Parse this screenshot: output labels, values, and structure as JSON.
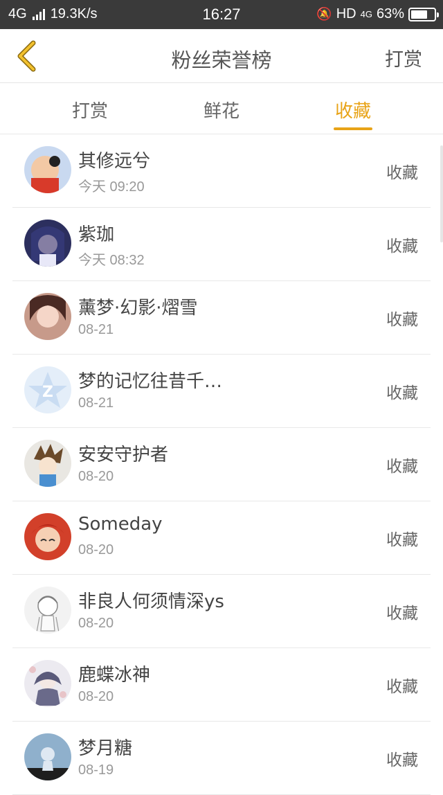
{
  "status_bar": {
    "network": "4G",
    "speed": "19.3K/s",
    "time": "16:27",
    "hd": "HD",
    "network2": "4G",
    "battery": "63%"
  },
  "nav": {
    "title": "粉丝荣誉榜",
    "action_label": "打赏"
  },
  "tabs": [
    {
      "label": "打赏",
      "active": false
    },
    {
      "label": "鲜花",
      "active": false
    },
    {
      "label": "收藏",
      "active": true
    }
  ],
  "accent_color": "#e8a317",
  "list": [
    {
      "name": "其修远兮",
      "time": "今天 09:20",
      "action": "收藏"
    },
    {
      "name": "紫珈",
      "time": "今天 08:32",
      "action": "收藏"
    },
    {
      "name": "薰梦·幻影·熠雪",
      "time": "08-21",
      "action": "收藏"
    },
    {
      "name": "梦的记忆往昔千…",
      "time": "08-21",
      "action": "收藏"
    },
    {
      "name": "安安守护者",
      "time": "08-20",
      "action": "收藏"
    },
    {
      "name": "Someday",
      "time": "08-20",
      "action": "收藏"
    },
    {
      "name": "非良人何须情深ys",
      "time": "08-20",
      "action": "收藏"
    },
    {
      "name": "鹿蝶冰神",
      "time": "08-20",
      "action": "收藏"
    },
    {
      "name": "梦月糖",
      "time": "08-19",
      "action": "收藏"
    }
  ]
}
